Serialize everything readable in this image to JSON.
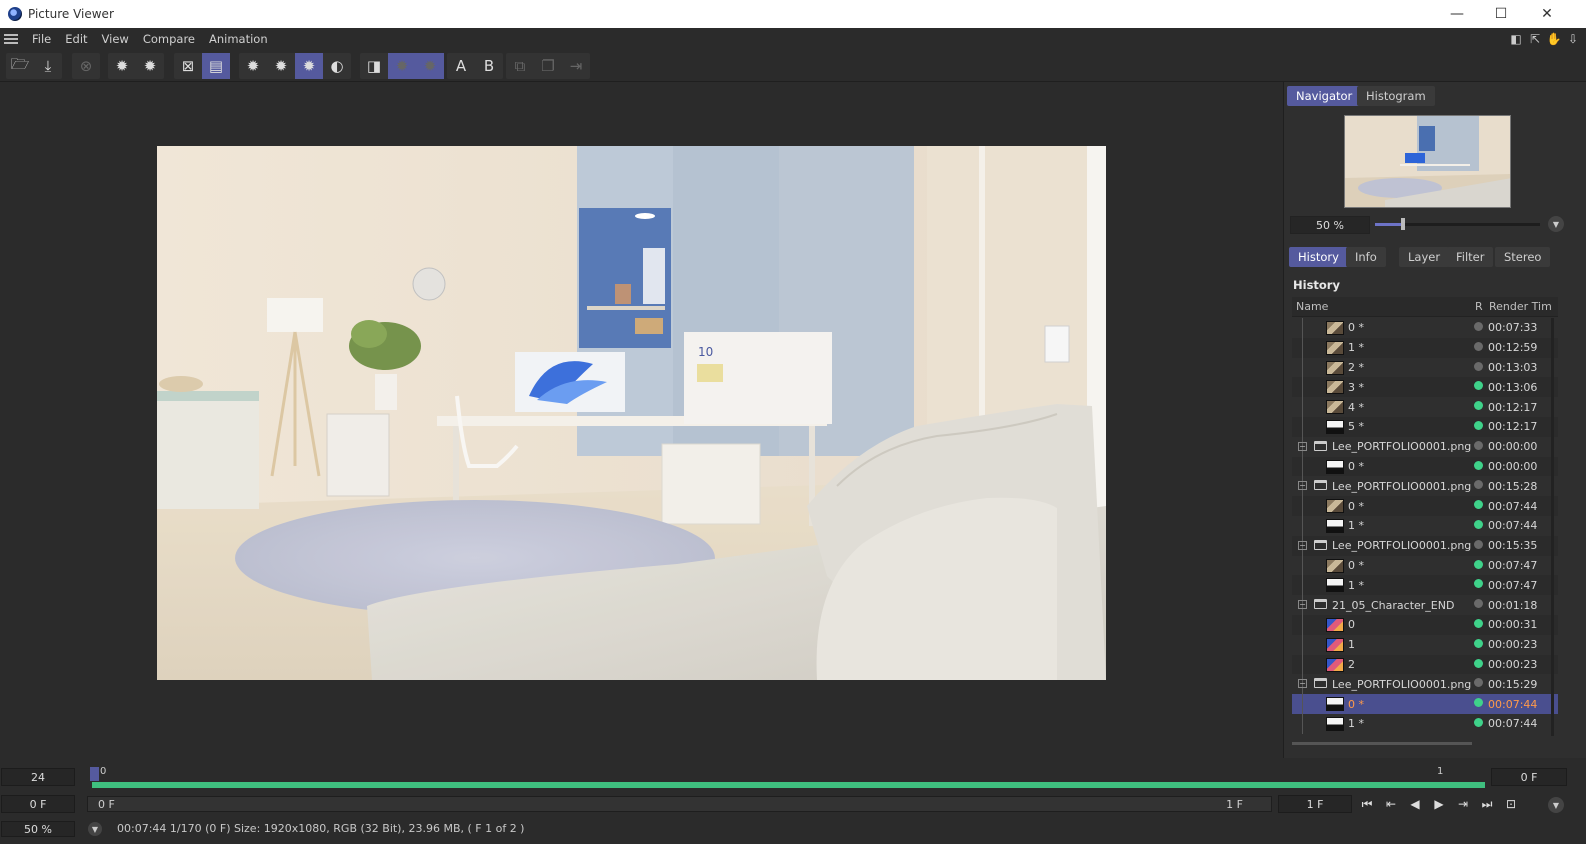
{
  "window": {
    "title": "Picture Viewer",
    "minimize": "—",
    "maximize": "☐",
    "close": "✕"
  },
  "menu": [
    "File",
    "Edit",
    "View",
    "Compare",
    "Animation"
  ],
  "toolbar": {
    "ab_a": "A",
    "ab_b": "B"
  },
  "navigator": {
    "tabs": [
      "Navigator",
      "Histogram"
    ],
    "zoom": "50 %",
    "zoom_level": 0.17
  },
  "panel_tabs": [
    "History",
    "Info",
    "Layer",
    "Filter",
    "Stereo"
  ],
  "history": {
    "title": "History",
    "col_name": "Name",
    "col_r": "R",
    "col_time": "Render Tim",
    "rows": [
      {
        "kind": "item",
        "label": "0 *",
        "status": "gray",
        "time": "00:07:33",
        "thumb": "room"
      },
      {
        "kind": "item",
        "label": "1 *",
        "status": "gray",
        "time": "00:12:59",
        "thumb": "room"
      },
      {
        "kind": "item",
        "label": "2 *",
        "status": "gray",
        "time": "00:13:03",
        "thumb": "room"
      },
      {
        "kind": "item",
        "label": "3 *",
        "status": "green",
        "time": "00:13:06",
        "thumb": "room"
      },
      {
        "kind": "item",
        "label": "4 *",
        "status": "green",
        "time": "00:12:17",
        "thumb": "room"
      },
      {
        "kind": "item",
        "label": "5 *",
        "status": "green",
        "time": "00:12:17",
        "thumb": "white"
      },
      {
        "kind": "folder",
        "label": "Lee_PORTFOLIO0001.png",
        "status": "gray",
        "time": "00:00:00"
      },
      {
        "kind": "item",
        "label": "0 *",
        "status": "green",
        "time": "00:00:00",
        "thumb": "white"
      },
      {
        "kind": "folder",
        "label": "Lee_PORTFOLIO0001.png",
        "status": "gray",
        "time": "00:15:28"
      },
      {
        "kind": "item",
        "label": "0 *",
        "status": "green",
        "time": "00:07:44",
        "thumb": "room"
      },
      {
        "kind": "item",
        "label": "1 *",
        "status": "green",
        "time": "00:07:44",
        "thumb": "white"
      },
      {
        "kind": "folder",
        "label": "Lee_PORTFOLIO0001.png",
        "status": "gray",
        "time": "00:15:35"
      },
      {
        "kind": "item",
        "label": "0 *",
        "status": "green",
        "time": "00:07:47",
        "thumb": "room"
      },
      {
        "kind": "item",
        "label": "1 *",
        "status": "green",
        "time": "00:07:47",
        "thumb": "white"
      },
      {
        "kind": "folder",
        "label": "21_05_Character_END",
        "status": "gray",
        "time": "00:01:18"
      },
      {
        "kind": "item",
        "label": "0",
        "status": "green",
        "time": "00:00:31",
        "thumb": "char"
      },
      {
        "kind": "item",
        "label": "1",
        "status": "green",
        "time": "00:00:23",
        "thumb": "char"
      },
      {
        "kind": "item",
        "label": "2",
        "status": "green",
        "time": "00:00:23",
        "thumb": "char"
      },
      {
        "kind": "folder",
        "label": "Lee_PORTFOLIO0001.png",
        "status": "gray",
        "time": "00:15:29"
      },
      {
        "kind": "item",
        "label": "0 *",
        "status": "green",
        "time": "00:07:44",
        "thumb": "white",
        "selected": true
      },
      {
        "kind": "item",
        "label": "1 *",
        "status": "green",
        "time": "00:07:44",
        "thumb": "white"
      }
    ]
  },
  "timeline": {
    "fps": "24",
    "current_frame_left": "0",
    "end_marker": "1",
    "frame_right": "0 F",
    "range_start_field": "0 F",
    "range_start": "0 F",
    "range_end": "1 F",
    "end_field": "1 F",
    "zoom": "50 %",
    "status": "00:07:44 1/170 (0 F)     Size: 1920x1080, RGB (32 Bit), 23.96 MB,  ( F 1 of 2 )"
  },
  "colors": {
    "accent": "#555a9e",
    "timeline_green": "#3fbf7f",
    "status_green": "#3fd28a",
    "selected_text": "#ff9a4a"
  }
}
